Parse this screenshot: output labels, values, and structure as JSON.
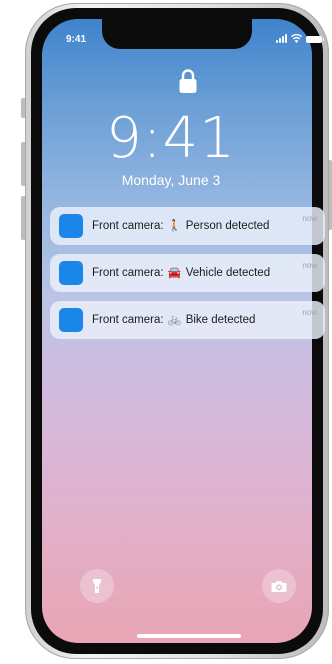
{
  "status_bar": {
    "time": "9:41",
    "icons": [
      "cellular-signal-icon",
      "wifi-icon",
      "battery-icon"
    ]
  },
  "lock_screen": {
    "lock_icon": "lock-icon",
    "time": "9:41",
    "date": "Monday, June 3"
  },
  "notifications": [
    {
      "prefix": "Front camera:",
      "emoji": "🚶",
      "label": "Person detected",
      "time": "now"
    },
    {
      "prefix": "Front camera:",
      "emoji": "🚘",
      "label": "Vehicle detected",
      "time": "now"
    },
    {
      "prefix": "Front camera:",
      "emoji": "🚲",
      "label": "Bike detected",
      "time": "now"
    }
  ],
  "controls": {
    "left_icon": "flashlight-icon",
    "right_icon": "camera-icon"
  },
  "colors": {
    "app_icon": "#1a86ea",
    "wallpaper_top": "#3f83cc",
    "wallpaper_bottom": "#e8a5b4"
  }
}
